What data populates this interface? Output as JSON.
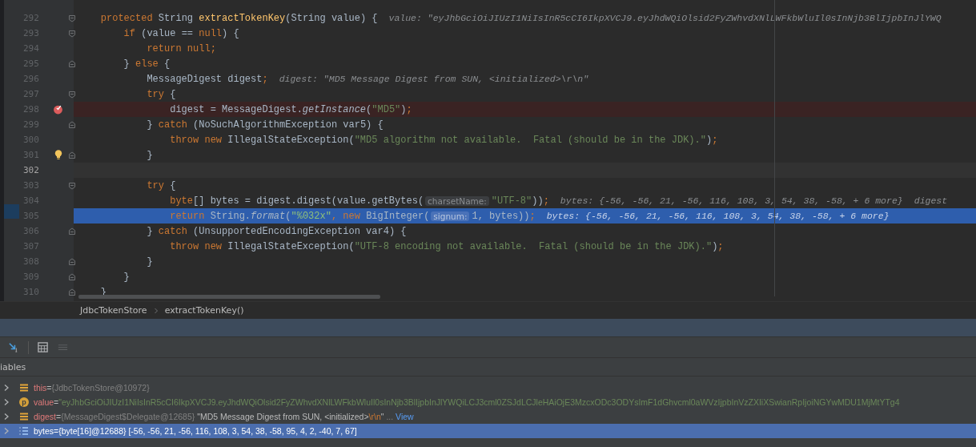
{
  "editor": {
    "lines": [
      {
        "number": "292",
        "kind": "plain",
        "fold_open": true,
        "fold_close": false,
        "bulb": false,
        "segments": [
          {
            "kind": "kw",
            "text": "    protected "
          },
          {
            "kind": "plain",
            "text": "String "
          },
          {
            "kind": "method",
            "text": "extractTokenKey"
          },
          {
            "kind": "plain",
            "text": "(String value) {"
          },
          {
            "kind": "hint",
            "text": "value: \"eyJhbGciOiJIUzI1NiIsInR5cCI6IkpXVCJ9.eyJhdWQiOlsid2FyZWhvdXNlLWFkbWluIl0sInNjb3BlIjpbInJlYWQ"
          }
        ]
      },
      {
        "number": "293",
        "kind": "plain",
        "fold_open": true,
        "fold_close": false,
        "bulb": false,
        "segments": [
          {
            "kind": "kw",
            "text": "        if "
          },
          {
            "kind": "plain",
            "text": "(value == "
          },
          {
            "kind": "kw",
            "text": "null"
          },
          {
            "kind": "plain",
            "text": ") {"
          }
        ]
      },
      {
        "number": "294",
        "kind": "plain",
        "fold_open": false,
        "fold_close": false,
        "bulb": false,
        "segments": [
          {
            "kind": "kw",
            "text": "            return null;"
          }
        ]
      },
      {
        "number": "295",
        "kind": "plain",
        "fold_open": false,
        "fold_close": true,
        "bulb": false,
        "segments": [
          {
            "kind": "plain",
            "text": "        } "
          },
          {
            "kind": "kw",
            "text": "else "
          },
          {
            "kind": "plain",
            "text": "{"
          }
        ]
      },
      {
        "number": "296",
        "kind": "plain",
        "fold_open": false,
        "fold_close": false,
        "bulb": false,
        "segments": [
          {
            "kind": "plain",
            "text": "            MessageDigest digest"
          },
          {
            "kind": "kw",
            "text": ";"
          },
          {
            "kind": "hint",
            "text": "digest: \"MD5 Message Digest from SUN, <initialized>\\r\\n\""
          }
        ]
      },
      {
        "number": "297",
        "kind": "plain",
        "fold_open": true,
        "fold_close": false,
        "bulb": false,
        "segments": [
          {
            "kind": "kw",
            "text": "            try "
          },
          {
            "kind": "plain",
            "text": "{"
          }
        ]
      },
      {
        "number": "298",
        "kind": "breakpoint",
        "fold_open": false,
        "fold_close": false,
        "bulb": false,
        "segments": [
          {
            "kind": "plain",
            "text": "                digest = MessageDigest."
          },
          {
            "kind": "italic",
            "text": "getInstance"
          },
          {
            "kind": "plain",
            "text": "("
          },
          {
            "kind": "string",
            "text": "\"MD5\""
          },
          {
            "kind": "plain",
            "text": ")"
          },
          {
            "kind": "kw",
            "text": ";"
          }
        ]
      },
      {
        "number": "299",
        "kind": "plain",
        "fold_open": false,
        "fold_close": true,
        "bulb": false,
        "segments": [
          {
            "kind": "plain",
            "text": "            } "
          },
          {
            "kind": "kw",
            "text": "catch "
          },
          {
            "kind": "plain",
            "text": "(NoSuchAlgorithmException var5) {"
          }
        ]
      },
      {
        "number": "300",
        "kind": "plain",
        "fold_open": false,
        "fold_close": false,
        "bulb": false,
        "segments": [
          {
            "kind": "kw",
            "text": "                throw new "
          },
          {
            "kind": "plain",
            "text": "IllegalStateException("
          },
          {
            "kind": "string",
            "text": "\"MD5 algorithm not available.  Fatal (should be in the JDK).\""
          },
          {
            "kind": "plain",
            "text": ")"
          },
          {
            "kind": "kw",
            "text": ";"
          }
        ]
      },
      {
        "number": "301",
        "kind": "plain",
        "fold_open": false,
        "fold_close": true,
        "bulb": true,
        "segments": [
          {
            "kind": "plain",
            "text": "            }"
          }
        ]
      },
      {
        "number": "302",
        "kind": "caret",
        "fold_open": false,
        "fold_close": false,
        "bulb": false
      },
      {
        "number": "303",
        "kind": "plain",
        "fold_open": true,
        "fold_close": false,
        "bulb": false,
        "segments": [
          {
            "kind": "kw",
            "text": "            try "
          },
          {
            "kind": "plain",
            "text": "{"
          }
        ]
      },
      {
        "number": "304",
        "kind": "plain",
        "fold_open": false,
        "fold_close": false,
        "bulb": false,
        "segments": [
          {
            "kind": "kw",
            "text": "                byte"
          },
          {
            "kind": "plain",
            "text": "[] bytes = digest.digest(value.getBytes("
          },
          {
            "kind": "param",
            "text": "charsetName:"
          },
          {
            "kind": "string",
            "text": "\"UTF-8\""
          },
          {
            "kind": "plain",
            "text": "))"
          },
          {
            "kind": "kw",
            "text": ";"
          },
          {
            "kind": "hint",
            "text": "bytes: {-56, -56, 21, -56, 116, 108, 3, 54, 38, -58, + 6 more}"
          },
          {
            "kind": "hint",
            "text": "digest"
          }
        ]
      },
      {
        "number": "305",
        "kind": "execution",
        "fold_open": false,
        "fold_close": false,
        "bulb": false,
        "segments": [
          {
            "kind": "kw",
            "text": "                return "
          },
          {
            "kind": "plain",
            "text": "String."
          },
          {
            "kind": "italic",
            "text": "format"
          },
          {
            "kind": "plain",
            "text": "("
          },
          {
            "kind": "string",
            "text": "\"%032x\""
          },
          {
            "kind": "kw",
            "text": ", new "
          },
          {
            "kind": "plain",
            "text": "BigInteger("
          },
          {
            "kind": "param",
            "text": "signum:"
          },
          {
            "kind": "plain",
            "text": "1, bytes))"
          },
          {
            "kind": "kw",
            "text": ";"
          },
          {
            "kind": "hint",
            "text": "bytes: {-56, -56, 21, -56, 116, 108, 3, 54, 38, -58, + 6 more}"
          }
        ]
      },
      {
        "number": "306",
        "kind": "plain",
        "fold_open": false,
        "fold_close": true,
        "bulb": false,
        "segments": [
          {
            "kind": "plain",
            "text": "            } "
          },
          {
            "kind": "kw",
            "text": "catch "
          },
          {
            "kind": "plain",
            "text": "(UnsupportedEncodingException var4) {"
          }
        ]
      },
      {
        "number": "307",
        "kind": "plain",
        "fold_open": false,
        "fold_close": false,
        "bulb": false,
        "segments": [
          {
            "kind": "kw",
            "text": "                throw new "
          },
          {
            "kind": "plain",
            "text": "IllegalStateException("
          },
          {
            "kind": "string",
            "text": "\"UTF-8 encoding not available.  Fatal (should be in the JDK).\""
          },
          {
            "kind": "plain",
            "text": ")"
          },
          {
            "kind": "kw",
            "text": ";"
          }
        ]
      },
      {
        "number": "308",
        "kind": "plain",
        "fold_open": false,
        "fold_close": true,
        "bulb": false,
        "segments": [
          {
            "kind": "plain",
            "text": "            }"
          }
        ]
      },
      {
        "number": "309",
        "kind": "plain",
        "fold_open": false,
        "fold_close": true,
        "bulb": false,
        "segments": [
          {
            "kind": "plain",
            "text": "        }"
          }
        ]
      },
      {
        "number": "310",
        "kind": "plain",
        "fold_open": false,
        "fold_close": true,
        "bulb": false,
        "segments": [
          {
            "kind": "plain",
            "text": "    }"
          }
        ]
      }
    ]
  },
  "breadcrumbs": [
    "JdbcTokenStore",
    "extractTokenKey()"
  ],
  "variables": {
    "title": "iables",
    "rows": [
      {
        "name": "this",
        "equals": "=",
        "kind": "field",
        "selected": false,
        "parts": [
          {
            "kind": "ref",
            "text": "{JdbcTokenStore@10972}"
          }
        ]
      },
      {
        "name": "value",
        "equals": "=",
        "kind": "param",
        "badge": "p",
        "selected": false,
        "parts": [
          {
            "kind": "str",
            "text": "\"eyJhbGciOiJIUzI1NiIsInR5cCI6IkpXVCJ9.eyJhdWQiOlsid2FyZWhvdXNlLWFkbWluIl0sInNjb3BlIjpbInJlYWQiLCJ3cml0ZSJdLCJleHAiOjE3MzcxODc3ODYsImF1dGhvcml0aWVzIjpbInVzZXIiXSwianRpIjoiNGYwMDU1MjMtYTg4"
          }
        ]
      },
      {
        "name": "digest",
        "equals": "=",
        "kind": "field",
        "selected": false,
        "parts": [
          {
            "kind": "ref",
            "text": "{MessageDigest$Delegate@12685}"
          },
          {
            "kind": "plain",
            "text": " \"MD5 Message Digest from SUN, <initialized>"
          },
          {
            "kind": "escape",
            "text": "\\r\\n"
          },
          {
            "kind": "plain",
            "text": "\""
          },
          {
            "kind": "ref",
            "text": " ... "
          },
          {
            "kind": "link",
            "text": "View"
          }
        ]
      },
      {
        "name": "bytes",
        "equals": "=",
        "kind": "array",
        "selected": true,
        "parts": [
          {
            "kind": "plain",
            "text": "{byte[16]@12688} [-56, -56, 21, -56, 116, 108, 3, 54, 38, -58, 95, 4, 2, -40, 7, 67]"
          }
        ]
      }
    ]
  }
}
